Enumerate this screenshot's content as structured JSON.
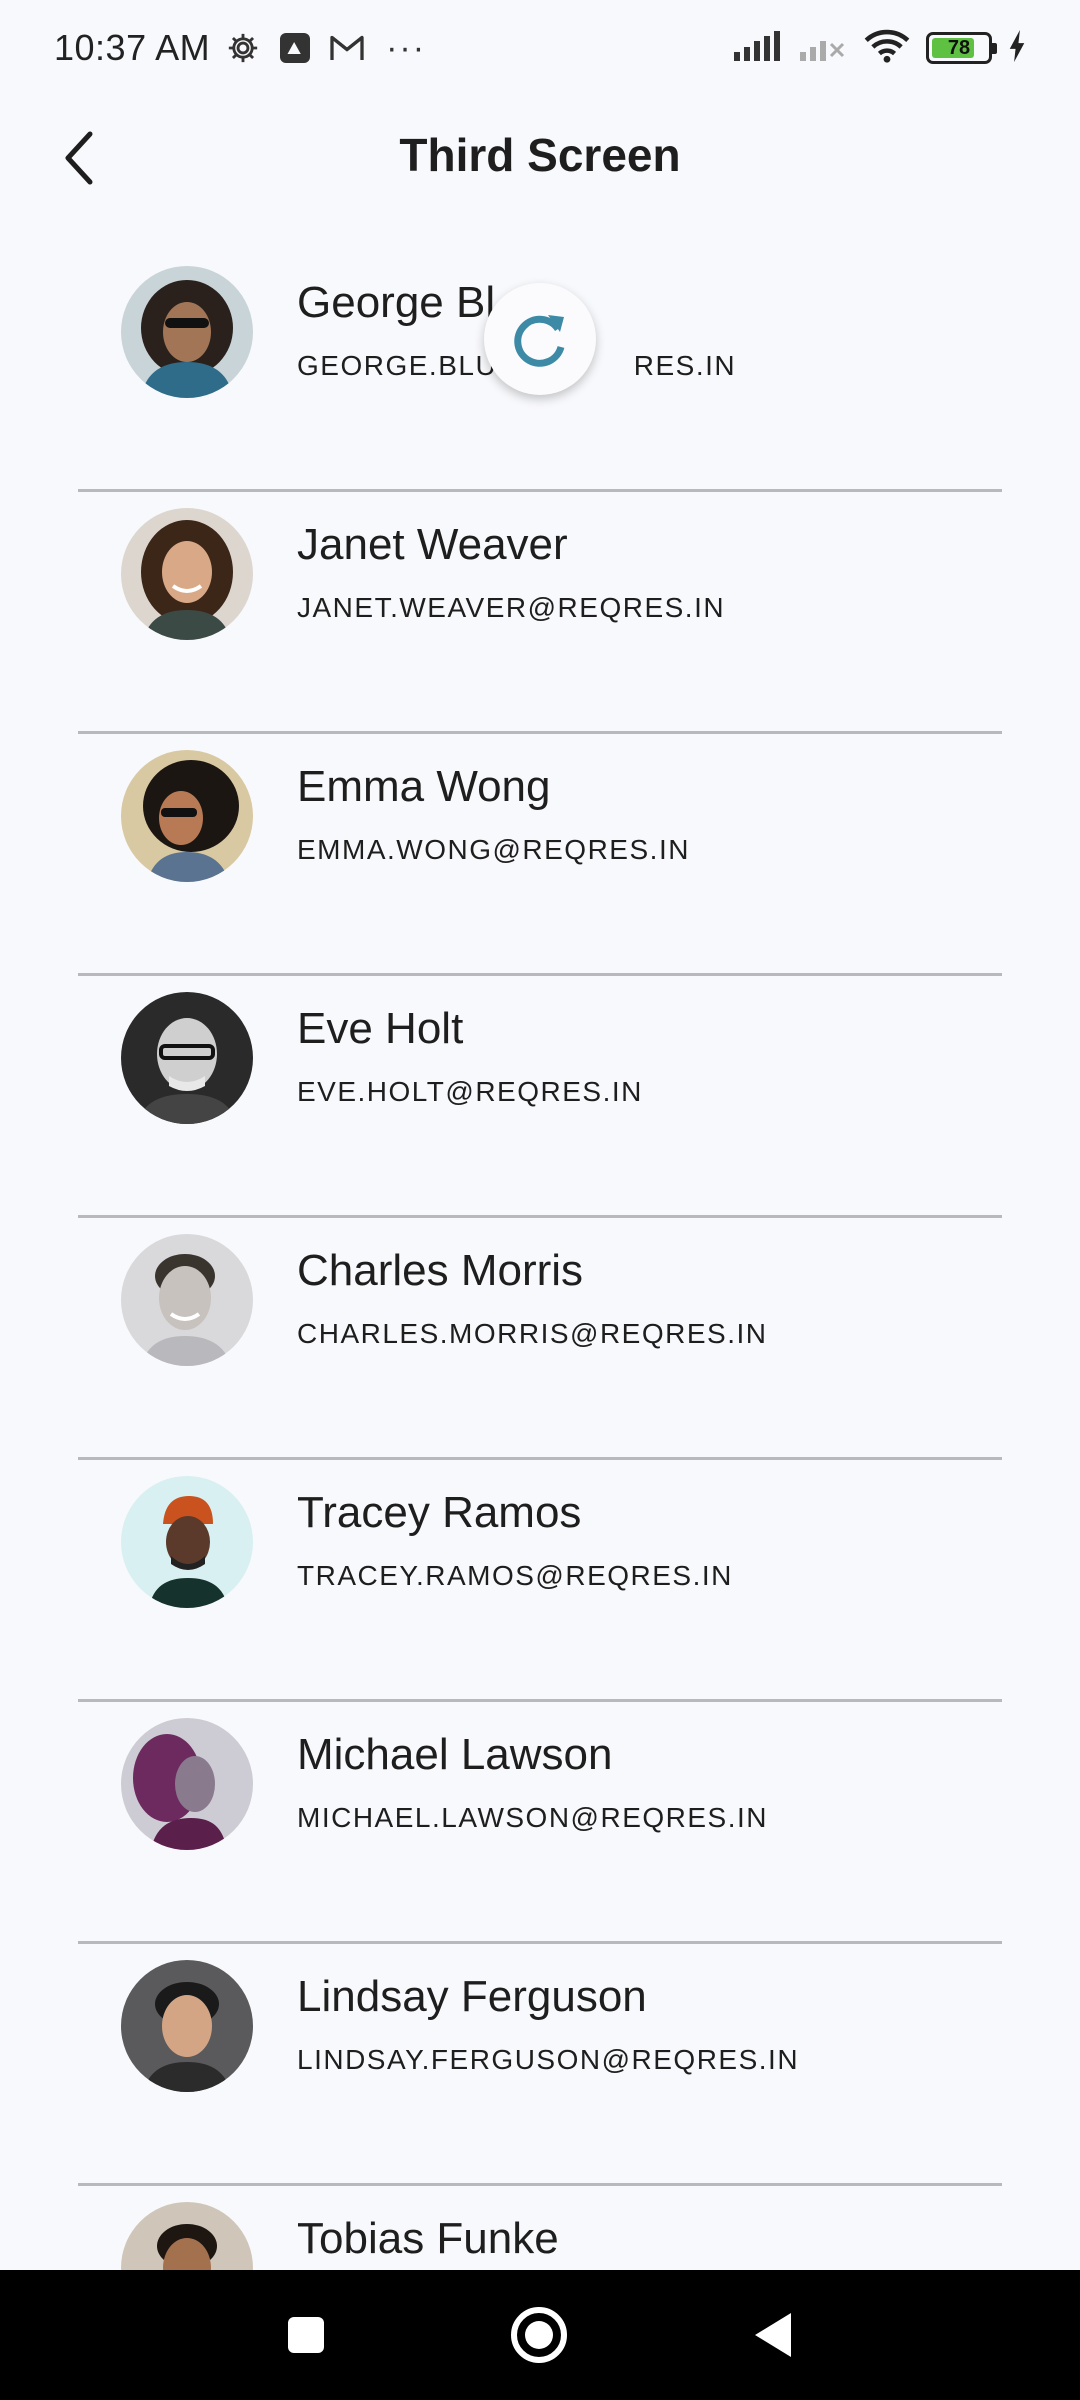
{
  "status_bar": {
    "time": "10:37 AM",
    "battery": "78",
    "battery_level_percent": 78,
    "icons": [
      "settings-icon",
      "tiktok-icon",
      "gmail-icon",
      "more-dots-icon",
      "signal-icon",
      "signal-no-service-icon",
      "wifi-icon",
      "battery-icon",
      "charging-icon"
    ],
    "more": "···"
  },
  "app_bar": {
    "title": "Third Screen",
    "back_icon": "chevron-left-icon"
  },
  "refresh_indicator": {
    "icon": "refresh-icon",
    "color": "#3d8aa6"
  },
  "users": [
    {
      "name": "George Bluth",
      "email": "GEORGE.BLUTH@REQRES.IN",
      "visible_name": "George Bl",
      "visible_email_left": "GEORGE.BLUT",
      "visible_email_right": "RES.IN"
    },
    {
      "name": "Janet Weaver",
      "email": "JANET.WEAVER@REQRES.IN"
    },
    {
      "name": "Emma Wong",
      "email": "EMMA.WONG@REQRES.IN"
    },
    {
      "name": "Eve Holt",
      "email": "EVE.HOLT@REQRES.IN"
    },
    {
      "name": "Charles Morris",
      "email": "CHARLES.MORRIS@REQRES.IN"
    },
    {
      "name": "Tracey Ramos",
      "email": "TRACEY.RAMOS@REQRES.IN"
    },
    {
      "name": "Michael Lawson",
      "email": "MICHAEL.LAWSON@REQRES.IN"
    },
    {
      "name": "Lindsay Ferguson",
      "email": "LINDSAY.FERGUSON@REQRES.IN"
    },
    {
      "name": "Tobias Funke",
      "email": ""
    }
  ],
  "nav_bar": {
    "buttons": [
      "recents-square-icon",
      "home-circle-icon",
      "back-triangle-icon"
    ]
  },
  "colors": {
    "background": "#f8f9fc",
    "divider": "#b9b9bd",
    "battery_fill": "#5ec142",
    "nav_bar": "#000000"
  }
}
